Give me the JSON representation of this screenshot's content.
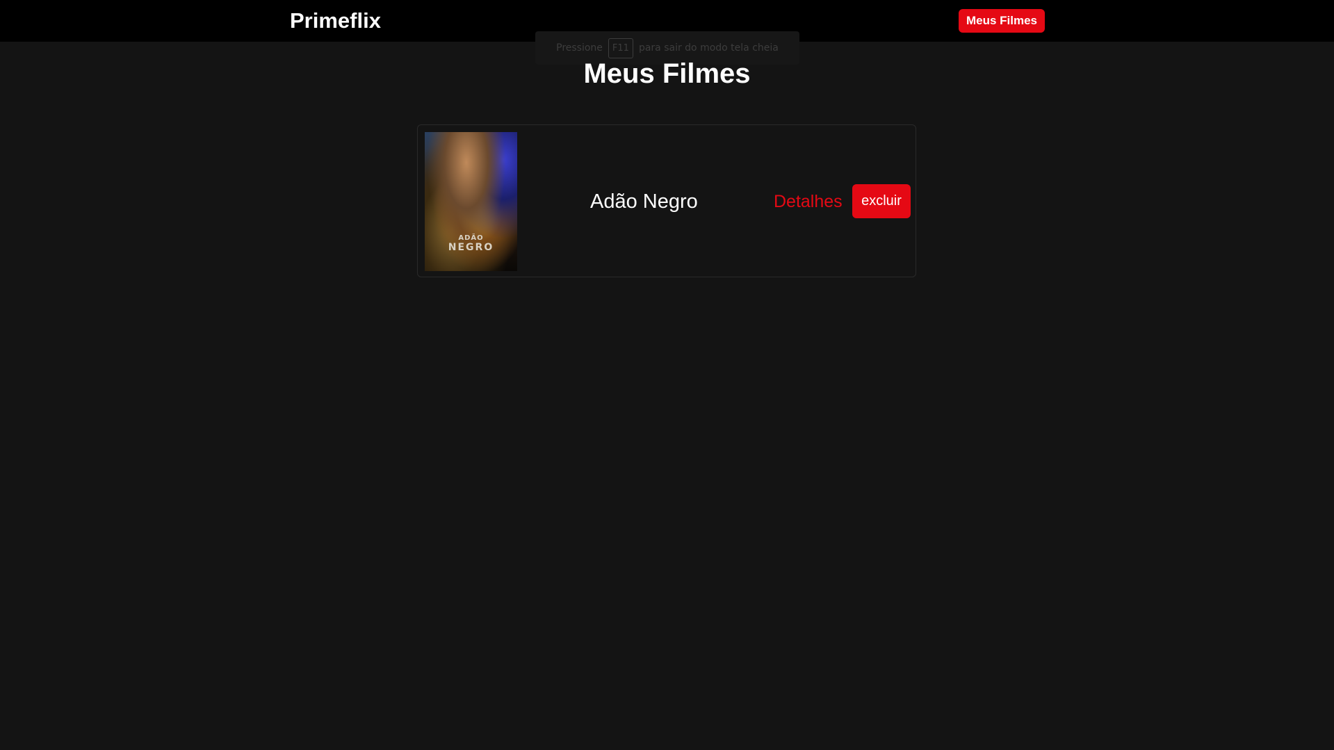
{
  "header": {
    "logo": "Primeflix",
    "nav_button_label": "Meus Filmes"
  },
  "fullscreen_toast": {
    "before_key": "Pressione",
    "key": "F11",
    "after_key": "para sair do modo tela cheia"
  },
  "main": {
    "title": "Meus Filmes",
    "movies": [
      {
        "title": "Adão Negro",
        "poster_text_line1": "ADÃO",
        "poster_text_line2": "NEGRO",
        "details_label": "Detalhes",
        "delete_label": "excluir"
      }
    ]
  },
  "colors": {
    "background": "#141414",
    "header_background": "#000000",
    "accent": "#e50914",
    "text": "#ffffff"
  }
}
